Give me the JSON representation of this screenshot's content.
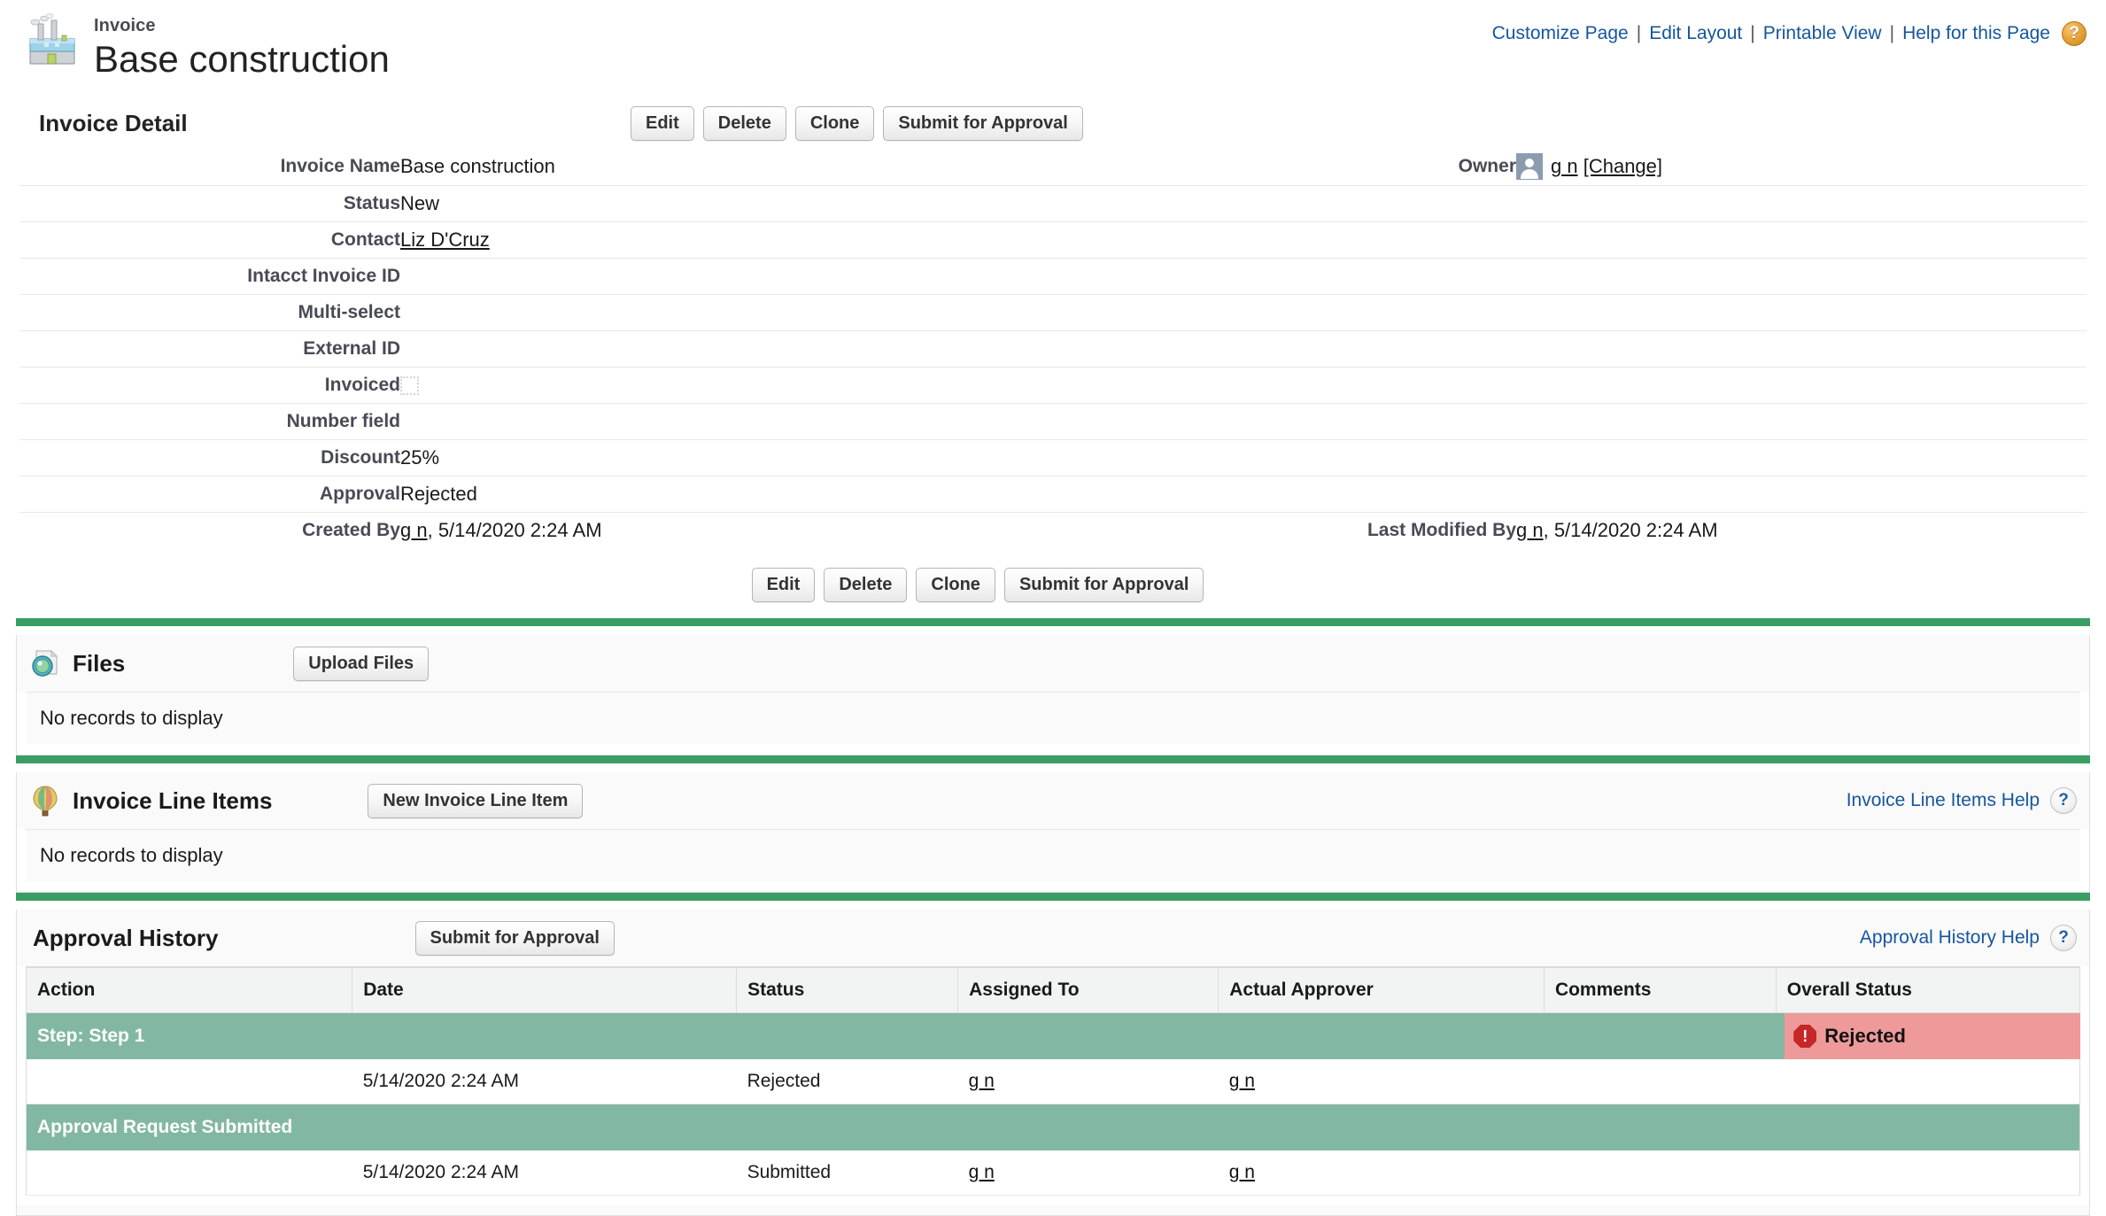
{
  "header": {
    "record_type": "Invoice",
    "record_name": "Base construction",
    "icon": "factory-icon",
    "links": [
      {
        "label": "Customize Page",
        "name": "customize-page-link"
      },
      {
        "label": "Edit Layout",
        "name": "edit-layout-link"
      },
      {
        "label": "Printable View",
        "name": "printable-view-link"
      },
      {
        "label": "Help for this Page",
        "name": "help-for-this-page-link"
      }
    ],
    "separator": "|",
    "help_icon_glyph": "?"
  },
  "detail": {
    "section_title": "Invoice Detail",
    "buttons": [
      {
        "label": "Edit",
        "name": "edit-button"
      },
      {
        "label": "Delete",
        "name": "delete-button"
      },
      {
        "label": "Clone",
        "name": "clone-button"
      },
      {
        "label": "Submit for Approval",
        "name": "submit-for-approval-button"
      }
    ],
    "fields_left": [
      {
        "label": "Invoice Name",
        "value": "Base construction",
        "type": "text"
      },
      {
        "label": "Status",
        "value": "New",
        "type": "text"
      },
      {
        "label": "Contact",
        "value": "Liz D'Cruz",
        "type": "link"
      },
      {
        "label": "Intacct Invoice ID",
        "value": "",
        "type": "text"
      },
      {
        "label": "Multi-select",
        "value": "",
        "type": "text"
      },
      {
        "label": "External ID",
        "value": "",
        "type": "text"
      },
      {
        "label": "Invoiced",
        "value": "",
        "type": "checkbox"
      },
      {
        "label": "Number field",
        "value": "",
        "type": "text"
      },
      {
        "label": "Discount",
        "value": "25%",
        "type": "text"
      },
      {
        "label": "Approval",
        "value": "Rejected",
        "type": "text"
      },
      {
        "label": "Created By",
        "value": "g n, 5/14/2020 2:24 AM",
        "type": "user-date",
        "user": "g n",
        "date": ", 5/14/2020 2:24 AM"
      }
    ],
    "owner": {
      "label": "Owner",
      "user": "g n",
      "change_label": "[Change]",
      "avatar": "user-avatar-icon"
    },
    "last_modified": {
      "label": "Last Modified By",
      "user": "g n",
      "date": ", 5/14/2020 2:24 AM"
    }
  },
  "files": {
    "title": "Files",
    "icon": "files-disc-icon",
    "button": "Upload Files",
    "empty_text": "No records to display"
  },
  "line_items": {
    "title": "Invoice Line Items",
    "icon": "balloon-icon",
    "button": "New Invoice Line Item",
    "help_link": "Invoice Line Items Help",
    "help_icon_glyph": "?",
    "empty_text": "No records to display"
  },
  "approval_history": {
    "title": "Approval History",
    "button": "Submit for Approval",
    "help_link": "Approval History Help",
    "help_icon_glyph": "?",
    "columns": [
      "Action",
      "Date",
      "Status",
      "Assigned To",
      "Actual Approver",
      "Comments",
      "Overall Status"
    ],
    "rows": [
      {
        "kind": "step",
        "action": "Step: Step 1",
        "date": "",
        "status": "",
        "assigned_to": "",
        "actual_approver": "",
        "comments": "",
        "overall_status": "Rejected",
        "overall_status_icon": "error-octagon-icon"
      },
      {
        "kind": "data",
        "action": "",
        "date": "5/14/2020 2:24 AM",
        "status": "Rejected",
        "assigned_to": "g n",
        "actual_approver": "g n",
        "comments": "",
        "overall_status": ""
      },
      {
        "kind": "step",
        "action": "Approval Request Submitted",
        "date": "",
        "status": "",
        "assigned_to": "",
        "actual_approver": "",
        "comments": "",
        "overall_status": ""
      },
      {
        "kind": "data",
        "action": "",
        "date": "5/14/2020 2:24 AM",
        "status": "Submitted",
        "assigned_to": "g n",
        "actual_approver": "g n",
        "comments": "",
        "overall_status": ""
      }
    ]
  },
  "colors": {
    "accent_green": "#3a9e64",
    "step_row_green": "#82b8a1",
    "rejected_badge": "#ef9a9a",
    "link_blue": "#15569e",
    "label_grey": "#4a4a56"
  }
}
